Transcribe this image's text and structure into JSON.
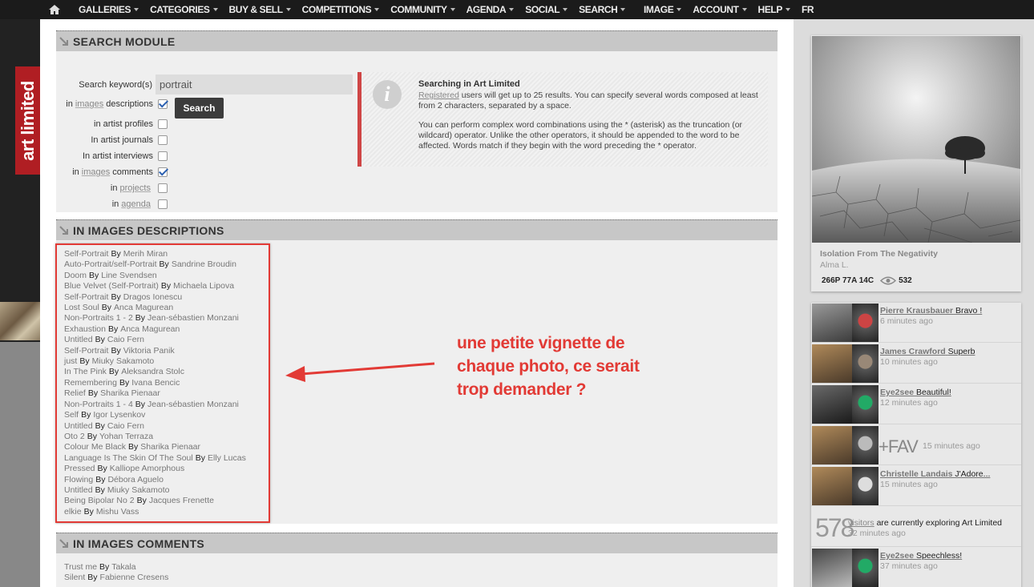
{
  "nav": {
    "left": [
      "GALLERIES",
      "CATEGORIES",
      "BUY & SELL",
      "COMPETITIONS",
      "COMMUNITY",
      "AGENDA",
      "SOCIAL",
      "SEARCH"
    ],
    "right": [
      "IMAGE",
      "ACCOUNT",
      "HELP"
    ],
    "lang": "FR",
    "home_icon": "home-icon"
  },
  "logo": {
    "text": "art limited"
  },
  "search_module": {
    "title": "SEARCH MODULE",
    "keyword_label": "Search keyword(s)",
    "keyword_value": "portrait",
    "search_button": "Search",
    "options": [
      {
        "pre": "in",
        "link": "images",
        "post": "descriptions",
        "checked": true
      },
      {
        "pre": "",
        "link": "",
        "post": "in artist profiles",
        "checked": false
      },
      {
        "pre": "",
        "link": "",
        "post": "In artist journals",
        "checked": false
      },
      {
        "pre": "",
        "link": "",
        "post": "In artist interviews",
        "checked": false
      },
      {
        "pre": "in",
        "link": "images",
        "post": "comments",
        "checked": true
      },
      {
        "pre": "in",
        "link": "projects",
        "post": "",
        "checked": false
      },
      {
        "pre": "in",
        "link": "agenda",
        "post": "",
        "checked": false
      }
    ],
    "info": {
      "title": "Searching in Art Limited",
      "p1_link": "Registered",
      "p1_rest": "users will get up to 25 results. You can specify several words composed at least from 2 characters, separated by a space.",
      "p2": "You can perform complex word combinations using the * (asterisk) as the truncation (or wildcard) operator. Unlike the other operators, it should be appended to the word to be affected. Words match if they begin with the word preceding the * operator."
    }
  },
  "descriptions_module": {
    "title": "IN IMAGES DESCRIPTIONS",
    "by_word": "By",
    "results": [
      {
        "title": "Self-Portrait",
        "author": "Merih Miran"
      },
      {
        "title": "Auto-Portrait/self-Portrait",
        "author": "Sandrine Broudin"
      },
      {
        "title": "Doom",
        "author": "Line Svendsen"
      },
      {
        "title": "Blue Velvet (Self-Portrait)",
        "author": "Michaela Lipova"
      },
      {
        "title": "Self-Portrait",
        "author": "Dragos Ionescu"
      },
      {
        "title": "Lost Soul",
        "author": "Anca Magurean"
      },
      {
        "title": "Non-Portraits 1 - 2",
        "author": "Jean-sébastien Monzani"
      },
      {
        "title": "Exhaustion",
        "author": "Anca Magurean"
      },
      {
        "title": "Untitled",
        "author": "Caio Fern"
      },
      {
        "title": "Self-Portrait",
        "author": "Viktoria Panik"
      },
      {
        "title": "just",
        "author": "Miuky Sakamoto"
      },
      {
        "title": "In The Pink",
        "author": "Aleksandra Stolc"
      },
      {
        "title": "Remembering",
        "author": "Ivana Bencic"
      },
      {
        "title": "Relief",
        "author": "Sharika Pienaar"
      },
      {
        "title": "Non-Portraits 1 - 4",
        "author": "Jean-sébastien Monzani"
      },
      {
        "title": "Self",
        "author": "Igor Lysenkov"
      },
      {
        "title": "Untitled",
        "author": "Caio Fern"
      },
      {
        "title": "Oto 2",
        "author": "Yohan Terraza"
      },
      {
        "title": "Colour Me Black",
        "author": "Sharika Pienaar"
      },
      {
        "title": "Language Is The Skin Of The Soul",
        "author": "Elly Lucas"
      },
      {
        "title": "Pressed",
        "author": "Kalliope Amorphous"
      },
      {
        "title": "Flowing",
        "author": "Débora Aguelo"
      },
      {
        "title": "Untitled",
        "author": "Miuky Sakamoto"
      },
      {
        "title": "Being Bipolar No 2",
        "author": "Jacques Frenette"
      },
      {
        "title": "elkie",
        "author": "Mishu Vass"
      }
    ]
  },
  "comments_module": {
    "title": "IN IMAGES COMMENTS",
    "results": [
      {
        "title": "Trust me",
        "author": "Takala"
      },
      {
        "title": "Silent",
        "author": "Fabienne Cresens"
      }
    ]
  },
  "annotation": {
    "text": "une petite vignette de\nchaque photo, ce serait\ntrop demander ?",
    "color": "#e23a35"
  },
  "featured": {
    "title": "Isolation From The Negativity",
    "author": "Alma L.",
    "stats": "266P 77A 14C",
    "views": "532"
  },
  "activity": [
    {
      "type": "comment",
      "name": "Pierre Krausbauer",
      "msg": "Bravo !",
      "time": "6 minutes ago"
    },
    {
      "type": "comment",
      "name": "James Crawford",
      "msg": "Superb",
      "time": "10 minutes ago"
    },
    {
      "type": "comment",
      "name": "Eye2see",
      "msg": "Beautiful!",
      "time": "12 minutes ago"
    },
    {
      "type": "fav",
      "label": "+FAV",
      "time": "15 minutes ago"
    },
    {
      "type": "comment",
      "name": "Christelle Landais",
      "msg": "J'Adore...",
      "time": "15 minutes ago"
    },
    {
      "type": "visitors",
      "count": "578",
      "link": "visitors",
      "rest": "are currently exploring Art Limited",
      "time": "32 minutes ago"
    },
    {
      "type": "comment",
      "name": "Eye2see",
      "msg": "Speechless!",
      "time": "37 minutes ago"
    }
  ]
}
